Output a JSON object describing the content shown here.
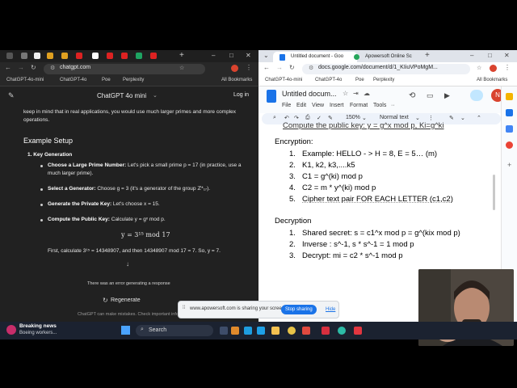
{
  "left_window": {
    "url": "chatgpt.com",
    "bookmarks": [
      "ChatGPT-4o-mini",
      "ChatGPT-4o",
      "Poe",
      "Perplexity",
      "All Bookmarks"
    ],
    "chat_title": "ChatGPT 4o mini",
    "login_label": "Log in",
    "intro_text": "keep in mind that in real applications, you would use much larger primes and more complex operations.",
    "section_heading": "Example Setup",
    "step1_label": "1.  Key Generation",
    "bullets": [
      {
        "bold": "Choose a Large Prime Number:",
        "text": " Let's pick a small prime p = 17 (in practice, use a much larger prime)."
      },
      {
        "bold": "Select a Generator:",
        "text": " Choose g = 3 (it's a generator of the group ℤ*₁₇)."
      },
      {
        "bold": "Generate the Private Key:",
        "text": " Let's choose x = 15."
      },
      {
        "bold": "Compute the Public Key:",
        "text": " Calculate y = gˣ  mod p."
      }
    ],
    "formula": "y = 3¹⁵   mod 17",
    "calc_text": "First, calculate 3¹⁵ = 14348907, and then 14348907  mod 17 = 7. So, y = 7.",
    "error_text": "There was an error generating a response",
    "regenerate_label": "Regenerate",
    "footer_text": "ChatGPT can make mistakes. Check important info."
  },
  "right_window": {
    "tabs": [
      "Untitled document - Goo",
      "Apowersoft Online Sc"
    ],
    "url": "docs.google.com/document/d/1_KIiuVPoMgM...",
    "bookmarks": [
      "ChatGPT-4o-mini",
      "ChatGPT-4o",
      "Poe",
      "Perplexity",
      "All Bookmarks"
    ],
    "doc_title": "Untitled docum...",
    "menus": [
      "File",
      "Edit",
      "View",
      "Insert",
      "Format",
      "Tools",
      "··"
    ],
    "zoom": "150%",
    "style_label": "Normal text",
    "doc": {
      "top_partial": "Compute the public key: y = g^x mod p, Ki=g^ki",
      "encryption_heading": "Encryption:",
      "encryption_items": [
        {
          "num": "1.",
          "text": "Example: HELLO - > H = 8, E = 5… (m)"
        },
        {
          "num": "2.",
          "text": "K1, k2, k3,....k5"
        },
        {
          "num": "3.",
          "text": "C1 = g^(ki) mod p"
        },
        {
          "num": "4.",
          "text": "C2 = m * y^(ki) mod p"
        },
        {
          "num": "5.",
          "text": "Cipher text pair FOR EACH LETTER (c1,c2)"
        }
      ],
      "decryption_heading": "Decryption",
      "decryption_items": [
        {
          "num": "1.",
          "text": "Shared secret: s = c1^x mod p = g^(kix mod p)"
        },
        {
          "num": "2.",
          "text": "Inverse : s^-1, s * s^-1 = 1 mod p"
        },
        {
          "num": "3.",
          "text": "Decrypt: mi = c2 * s^-1 mod p"
        }
      ]
    }
  },
  "share_bar": {
    "text": "www.apowersoft.com is sharing your screen.",
    "stop_label": "Stop sharing",
    "hide_label": "Hide"
  },
  "taskbar": {
    "news_title": "Breaking news",
    "news_sub": "Boeing workers...",
    "search_label": "Search"
  },
  "colors": {
    "chat_bg": "#212121",
    "docs_blue": "#1a73e8",
    "taskbar": "#1b2230"
  }
}
